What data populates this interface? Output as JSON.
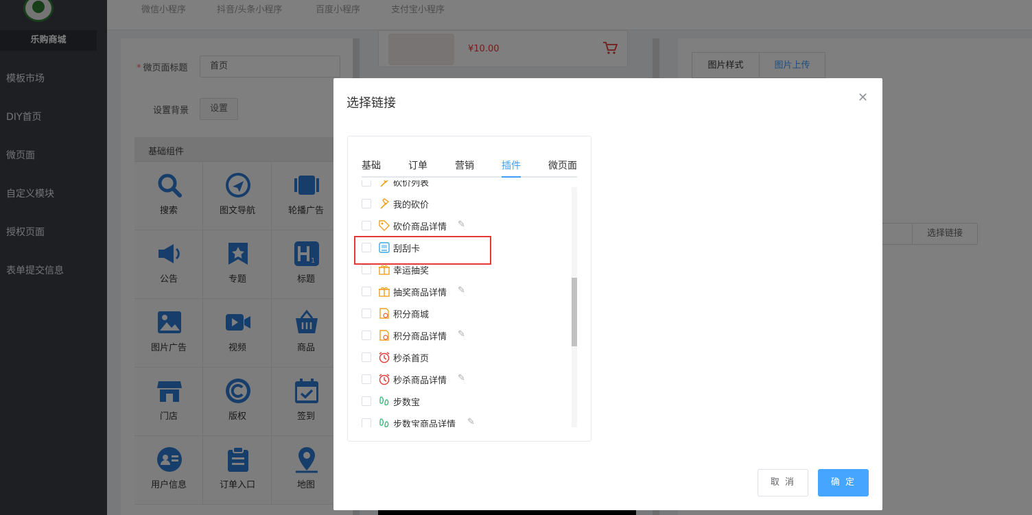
{
  "sidebar": {
    "brand": "乐购商城",
    "items": [
      {
        "label": "模板市场"
      },
      {
        "label": "DIY首页"
      },
      {
        "label": "微页面"
      },
      {
        "label": "自定义模块"
      },
      {
        "label": "授权页面"
      },
      {
        "label": "表单提交信息"
      }
    ]
  },
  "topbar": {
    "tabs": [
      {
        "label": "微信小程序"
      },
      {
        "label": "抖音/头条小程序"
      },
      {
        "label": "百度小程序"
      },
      {
        "label": "支付宝小程序"
      }
    ]
  },
  "form": {
    "title_label": "微页面标题",
    "title_value": "首页",
    "bg_label": "设置背景",
    "bg_button": "设置"
  },
  "components": {
    "header": "基础组件",
    "items": [
      {
        "label": "搜索",
        "icon": "search-icon"
      },
      {
        "label": "图文导航",
        "icon": "navigation-icon"
      },
      {
        "label": "轮播广告",
        "icon": "carousel-icon"
      },
      {
        "label": "公告",
        "icon": "megaphone-icon"
      },
      {
        "label": "专题",
        "icon": "star-bookmark-icon"
      },
      {
        "label": "标题",
        "icon": "heading-icon"
      },
      {
        "label": "图片广告",
        "icon": "image-icon"
      },
      {
        "label": "视频",
        "icon": "video-icon"
      },
      {
        "label": "商品",
        "icon": "basket-icon"
      },
      {
        "label": "门店",
        "icon": "store-icon"
      },
      {
        "label": "版权",
        "icon": "copyright-icon"
      },
      {
        "label": "签到",
        "icon": "calendar-check-icon"
      },
      {
        "label": "用户信息",
        "icon": "user-card-icon"
      },
      {
        "label": "订单入口",
        "icon": "clipboard-icon"
      },
      {
        "label": "地图",
        "icon": "map-pin-icon"
      }
    ]
  },
  "preview": {
    "price": "¥10.00"
  },
  "right_panel": {
    "tabs": [
      {
        "label": "图片样式"
      },
      {
        "label": "图片上传"
      }
    ],
    "select_link_button": "选择链接"
  },
  "modal": {
    "title": "选择链接",
    "tabs": [
      {
        "label": "基础"
      },
      {
        "label": "订单"
      },
      {
        "label": "营销"
      },
      {
        "label": "插件"
      },
      {
        "label": "微页面"
      }
    ],
    "active_tab": "插件",
    "rows": [
      {
        "label": "砍价列表",
        "icon": "axe-icon",
        "editable": false
      },
      {
        "label": "我的砍价",
        "icon": "axe-icon",
        "editable": false
      },
      {
        "label": "砍价商品详情",
        "icon": "price-tag-icon",
        "editable": true
      },
      {
        "label": "刮刮卡",
        "icon": "scratch-card-icon",
        "editable": false
      },
      {
        "label": "幸运抽奖",
        "icon": "gift-icon",
        "editable": false
      },
      {
        "label": "抽奖商品详情",
        "icon": "gift-icon",
        "editable": true
      },
      {
        "label": "积分商城",
        "icon": "points-icon",
        "editable": false
      },
      {
        "label": "积分商品详情",
        "icon": "points-icon",
        "editable": true
      },
      {
        "label": "秒杀首页",
        "icon": "alarm-clock-icon",
        "editable": false
      },
      {
        "label": "秒杀商品详情",
        "icon": "alarm-clock-icon",
        "editable": true
      },
      {
        "label": "步数宝",
        "icon": "footprint-icon",
        "editable": false
      },
      {
        "label": "步数宝商品详情",
        "icon": "footprint-icon",
        "editable": true
      }
    ],
    "cancel": "取 消",
    "confirm": "确 定"
  },
  "colors": {
    "sidebar_bg": "#3a3f47",
    "primary": "#409eff",
    "highlight": "#e53935",
    "price": "#e53935"
  }
}
